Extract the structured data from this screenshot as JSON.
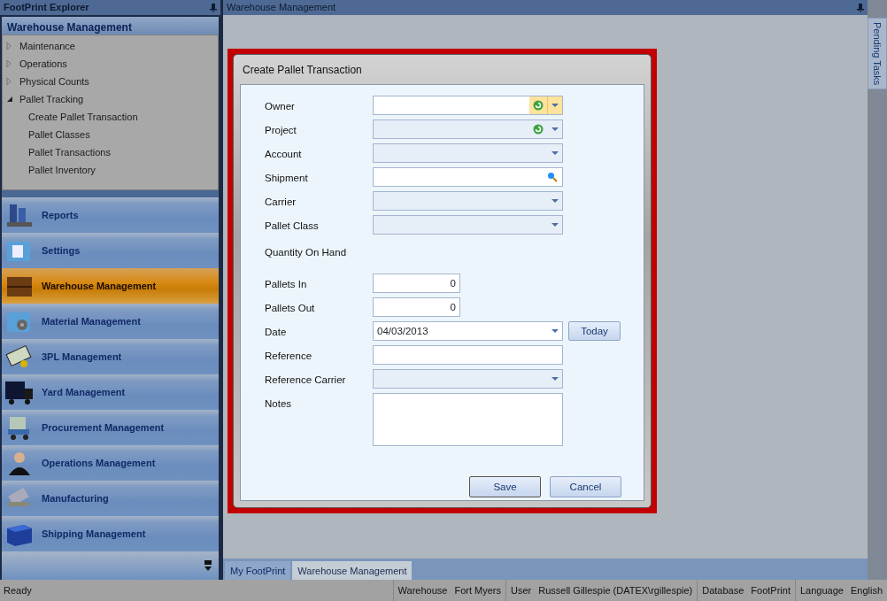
{
  "explorer": {
    "title": "FootPrint Explorer",
    "header": "Warehouse Management",
    "tree": [
      {
        "label": "Maintenance",
        "expanded": false
      },
      {
        "label": "Operations",
        "expanded": false
      },
      {
        "label": "Physical Counts",
        "expanded": false
      },
      {
        "label": "Pallet Tracking",
        "expanded": true,
        "children": [
          {
            "label": "Create Pallet Transaction"
          },
          {
            "label": "Pallet Classes"
          },
          {
            "label": "Pallet Transactions"
          },
          {
            "label": "Pallet Inventory"
          }
        ]
      }
    ],
    "nav": [
      {
        "label": "Reports",
        "selected": false
      },
      {
        "label": "Settings",
        "selected": false
      },
      {
        "label": "Warehouse Management",
        "selected": true
      },
      {
        "label": "Material Management",
        "selected": false
      },
      {
        "label": "3PL Management",
        "selected": false
      },
      {
        "label": "Yard Management",
        "selected": false
      },
      {
        "label": "Procurement Management",
        "selected": false
      },
      {
        "label": "Operations Management",
        "selected": false
      },
      {
        "label": "Manufacturing",
        "selected": false
      },
      {
        "label": "Shipping Management",
        "selected": false
      }
    ]
  },
  "workspace": {
    "title": "Warehouse Management",
    "side_tab": "Pending Tasks",
    "tabs": [
      {
        "label": "My FootPrint",
        "selected": false
      },
      {
        "label": "Warehouse Management",
        "selected": true
      }
    ]
  },
  "dialog": {
    "title": "Create Pallet Transaction",
    "fields": [
      {
        "label": "Owner",
        "kind": "combo",
        "refresh": true,
        "disabled": false,
        "focused": true
      },
      {
        "label": "Project",
        "kind": "combo",
        "refresh": true,
        "disabled": true,
        "focused": false
      },
      {
        "label": "Account",
        "kind": "combo",
        "refresh": false,
        "disabled": true,
        "focused": false
      },
      {
        "label": "Shipment",
        "kind": "lookup",
        "disabled": false
      },
      {
        "label": "Carrier",
        "kind": "combo",
        "refresh": false,
        "disabled": true,
        "focused": false
      },
      {
        "label": "Pallet Class",
        "kind": "combo",
        "refresh": false,
        "disabled": true,
        "focused": false
      },
      {
        "label": "Quantity On Hand",
        "kind": "static"
      },
      {
        "label": "Pallets In",
        "kind": "number",
        "value": "0"
      },
      {
        "label": "Pallets Out",
        "kind": "number",
        "value": "0"
      },
      {
        "label": "Date",
        "kind": "date",
        "value": "04/03/2013",
        "button": "Today"
      },
      {
        "label": "Reference",
        "kind": "text"
      },
      {
        "label": "Reference Carrier",
        "kind": "combo",
        "refresh": false,
        "disabled": true,
        "focused": false
      },
      {
        "label": "Notes",
        "kind": "memo"
      }
    ],
    "buttons": [
      "Save",
      "Cancel"
    ]
  },
  "status_bar": {
    "text": "Ready",
    "segments": [
      {
        "label": "Warehouse",
        "value": "Fort Myers"
      },
      {
        "label": "User",
        "value": "Russell Gillespie (DATEX\\rgillespie)"
      },
      {
        "label": "Database",
        "value": "FootPrint"
      },
      {
        "label": "Language",
        "value": "English"
      }
    ]
  }
}
